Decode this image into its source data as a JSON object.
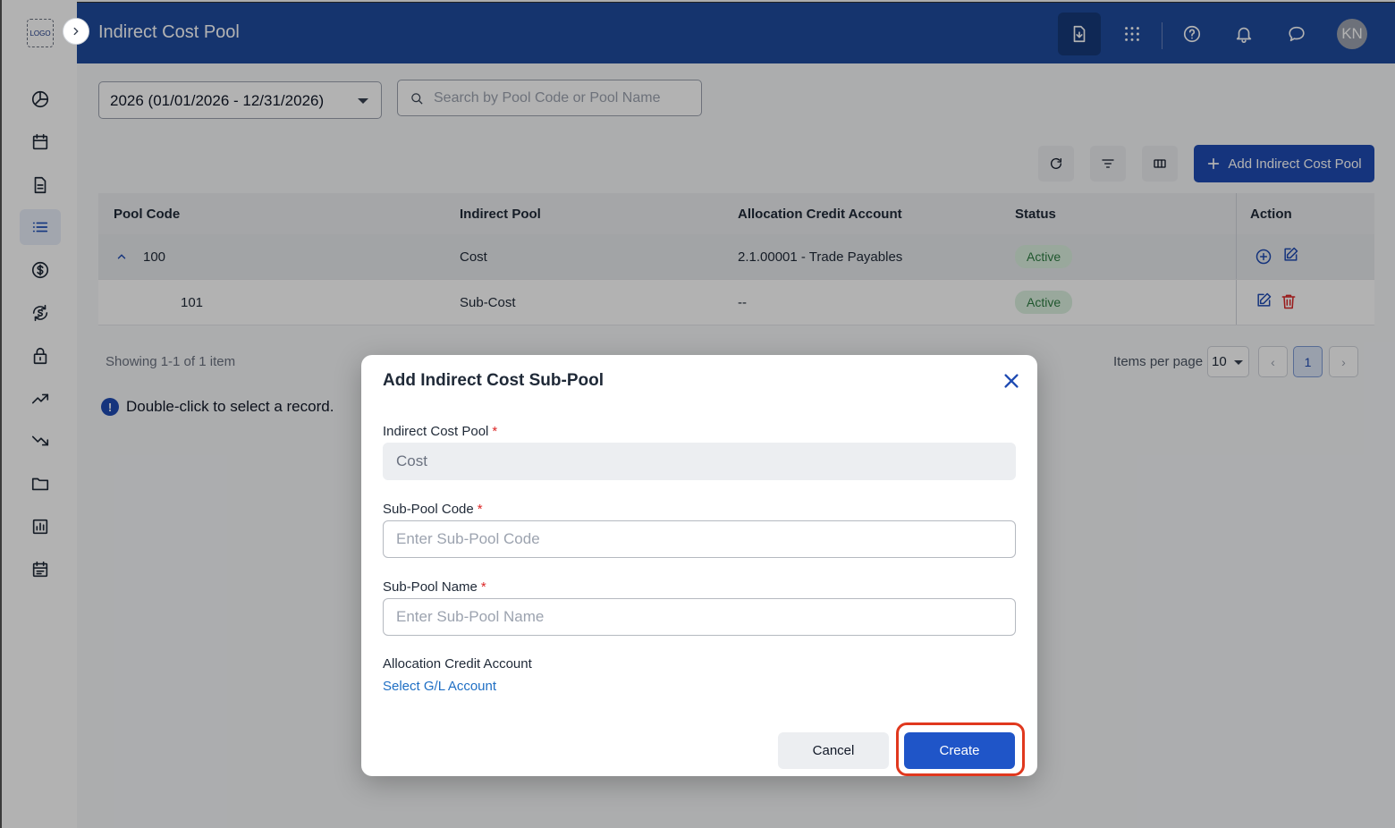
{
  "app": {
    "logo_text": "LOGO",
    "page_title": "Indirect Cost Pool",
    "avatar_initials": "KN"
  },
  "sidebar": {
    "items": [
      {
        "name": "dashboard-icon"
      },
      {
        "name": "calendar-icon"
      },
      {
        "name": "document-icon"
      },
      {
        "name": "list-icon",
        "active": true
      },
      {
        "name": "dollar-icon"
      },
      {
        "name": "currency-sync-icon"
      },
      {
        "name": "lock-icon"
      },
      {
        "name": "trend-up-icon"
      },
      {
        "name": "trend-down-icon"
      },
      {
        "name": "folder-icon"
      },
      {
        "name": "report-chart-icon"
      },
      {
        "name": "schedule-icon"
      }
    ]
  },
  "header": {
    "icons": [
      "export-document-icon",
      "apps-grid-icon",
      "help-icon",
      "notification-bell-icon",
      "chat-icon"
    ]
  },
  "filters": {
    "year_value": "2026 (01/01/2026 - 12/31/2026)",
    "search_placeholder": "Search by Pool Code or Pool Name"
  },
  "toolbar": {
    "add_pool_label": "Add Indirect Cost Pool"
  },
  "table": {
    "columns": [
      "Pool Code",
      "Indirect Pool",
      "Allocation Credit Account",
      "Status",
      "Action"
    ],
    "rows": [
      {
        "code": "100",
        "pool": "Cost",
        "account": "2.1.00001 - Trade Payables",
        "status": "Active",
        "expanded": true
      },
      {
        "code": "101",
        "pool": "Sub-Cost",
        "account": "--",
        "status": "Active"
      }
    ]
  },
  "footer": {
    "showing": "Showing 1-1 of 1 item",
    "hint": "Double-click to select a record.",
    "items_per_page_label": "Items per page",
    "items_per_page_value": "10",
    "current_page": "1"
  },
  "modal": {
    "title": "Add Indirect Cost Sub-Pool",
    "pool_label": "Indirect Cost Pool",
    "pool_value": "Cost",
    "code_label": "Sub-Pool Code",
    "code_placeholder": "Enter Sub-Pool Code",
    "name_label": "Sub-Pool Name",
    "name_placeholder": "Enter Sub-Pool Name",
    "account_label": "Allocation Credit Account",
    "account_link": "Select G/L Account",
    "cancel_label": "Cancel",
    "create_label": "Create",
    "required_mark": "*"
  },
  "colors": {
    "header_bg": "#1f4b9e",
    "primary": "#1f55c8",
    "status_active_bg": "#dcf1e0",
    "status_active_text": "#2e7d43",
    "highlight": "#e0381e",
    "danger": "#dc2626"
  }
}
